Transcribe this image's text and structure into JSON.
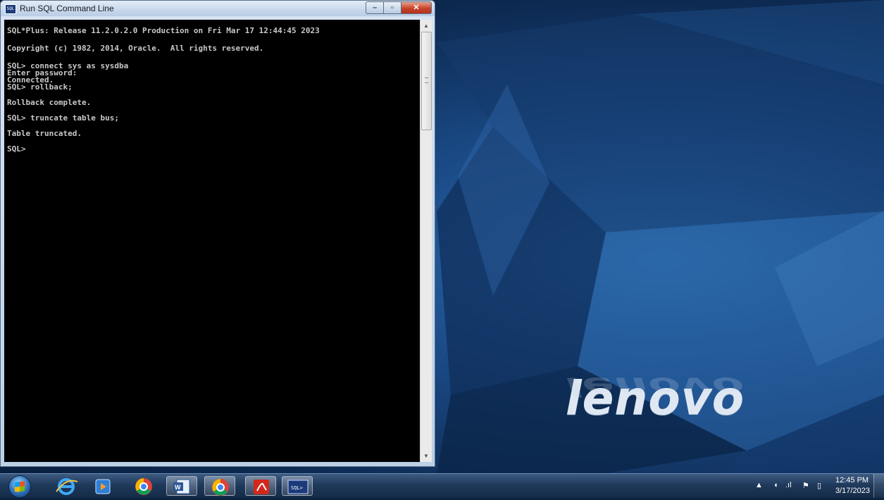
{
  "window": {
    "title": "Run SQL Command Line",
    "app_icon_text": "SQL",
    "min_label": "–",
    "max_label": "▫",
    "close_label": "✕"
  },
  "console": {
    "lines": [
      "SQL*Plus: Release 11.2.0.2.0 Production on Fri Mar 17 12:44:45 2023",
      "Copyright (c) 1982, 2014, Oracle.  All rights reserved.",
      "SQL> connect sys as sysdba",
      "Enter password:",
      "Connected.",
      "SQL> rollback;",
      "Rollback complete.",
      "SQL> truncate table bus;",
      "Table truncated.",
      "SQL>"
    ]
  },
  "desktop": {
    "brand": "lenovo"
  },
  "taskbar": {
    "items": [
      {
        "icon": "internet-explorer-icon"
      },
      {
        "icon": "media-player-icon"
      },
      {
        "icon": "chrome-icon"
      },
      {
        "icon": "word-icon"
      },
      {
        "icon": "chrome-icon"
      },
      {
        "icon": "acrobat-icon"
      },
      {
        "icon": "sql-command-line-icon",
        "label": "SQL>"
      }
    ],
    "tray": {
      "time": "12:45 PM",
      "date": "3/17/2023"
    }
  },
  "colors": {
    "console_bg": "#000000",
    "console_text": "#c8c8c8",
    "close_red": "#c7432a"
  }
}
